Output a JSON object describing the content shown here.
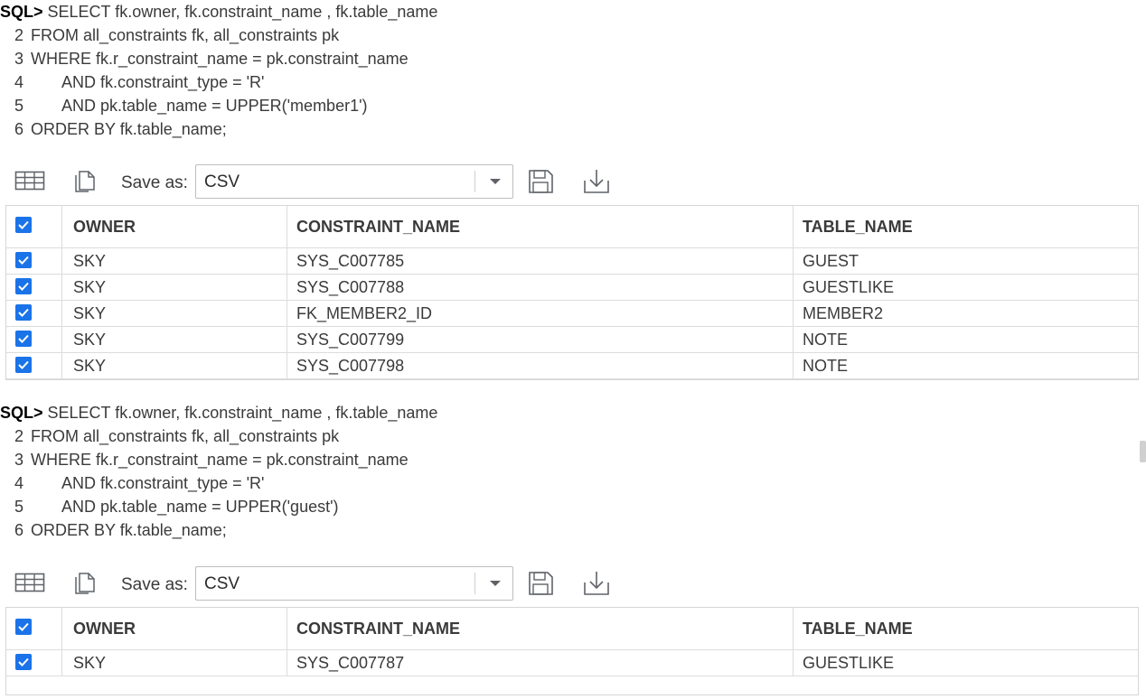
{
  "blocks": [
    {
      "prompt": "SQL>",
      "lines": [
        {
          "num": "",
          "text": " SELECT fk.owner, fk.constraint_name , fk.table_name"
        },
        {
          "num": "2",
          "text": "FROM all_constraints fk, all_constraints pk"
        },
        {
          "num": "3",
          "text": "WHERE fk.r_constraint_name = pk.constraint_name"
        },
        {
          "num": "4",
          "text": "       AND fk.constraint_type = 'R'"
        },
        {
          "num": "5",
          "text": "       AND pk.table_name = UPPER('member1')"
        },
        {
          "num": "6",
          "text": "ORDER BY fk.table_name;"
        }
      ],
      "toolbar": {
        "save_as_label": "Save as:",
        "format_value": "CSV"
      },
      "columns": [
        "OWNER",
        "CONSTRAINT_NAME",
        "TABLE_NAME"
      ],
      "rows": [
        [
          "SKY",
          "SYS_C007785",
          "GUEST"
        ],
        [
          "SKY",
          "SYS_C007788",
          "GUESTLIKE"
        ],
        [
          "SKY",
          "FK_MEMBER2_ID",
          "MEMBER2"
        ],
        [
          "SKY",
          "SYS_C007799",
          "NOTE"
        ],
        [
          "SKY",
          "SYS_C007798",
          "NOTE"
        ]
      ]
    },
    {
      "prompt": "SQL>",
      "lines": [
        {
          "num": "",
          "text": " SELECT fk.owner, fk.constraint_name , fk.table_name"
        },
        {
          "num": "2",
          "text": "FROM all_constraints fk, all_constraints pk"
        },
        {
          "num": "3",
          "text": "WHERE fk.r_constraint_name = pk.constraint_name"
        },
        {
          "num": "4",
          "text": "       AND fk.constraint_type = 'R'"
        },
        {
          "num": "5",
          "text": "       AND pk.table_name = UPPER('guest')"
        },
        {
          "num": "6",
          "text": "ORDER BY fk.table_name;"
        }
      ],
      "toolbar": {
        "save_as_label": "Save as:",
        "format_value": "CSV"
      },
      "columns": [
        "OWNER",
        "CONSTRAINT_NAME",
        "TABLE_NAME"
      ],
      "rows": [
        [
          "SKY",
          "SYS_C007787",
          "GUESTLIKE"
        ]
      ]
    }
  ],
  "colors": {
    "checkbox": "#1a73e8",
    "border": "#dcdcdc",
    "text": "#3a3a3a"
  },
  "icons": [
    "grid-view-icon",
    "copy-icon",
    "save-icon",
    "download-icon",
    "chevron-down-icon",
    "checkbox-checked-icon"
  ]
}
